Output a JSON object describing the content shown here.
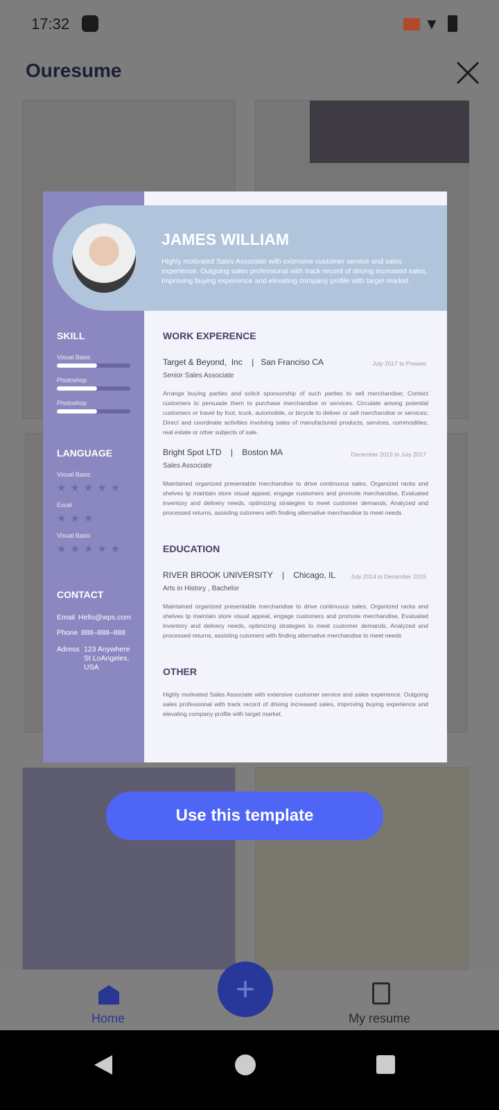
{
  "status": {
    "time": "17:32"
  },
  "app": {
    "title": "Ouresume"
  },
  "preview": {
    "name": "JAMES WILLIAM",
    "summary": "Highly motivated Sales Associate with extensive customer service and sales experience. Outgoing sales professional with track record of driving increased sales,  Improving buying experience and elevating company profile with target market.",
    "skill_title": "SKILL",
    "skills": [
      {
        "label": "Visual Basic",
        "level": 0.55
      },
      {
        "label": "Photoshop",
        "level": 0.55
      },
      {
        "label": "Photoshop",
        "level": 0.55
      }
    ],
    "language_title": "LANGUAGE",
    "languages": [
      {
        "label": "Visual Basic",
        "stars": "★★★★★",
        "rating": 5
      },
      {
        "label": "Excel",
        "stars": "★★★",
        "rating": 3
      },
      {
        "label": "Visual Basic",
        "stars": "★★★★★",
        "rating": 5
      }
    ],
    "contact_title": "CONTACT",
    "contact": {
      "email_label": "Email",
      "email": "Hello@wps.com",
      "phone_label": "Phone",
      "phone": "888–888–888",
      "address_label": "Adress",
      "address": "123 Anywhere St LoAngeles, USA"
    },
    "work_title": "WORK EXPERENCE",
    "jobs": [
      {
        "company": "Target & Beyond,  Inc    |   San Franciso CA",
        "role": "Senior Sales Associate",
        "date": "July 2017 to Present",
        "desc": "Arrange buying parties and solicit sponsorship of such parties to sell merchandise; Contact customers to persuade them to purchase merchandise or services. Circulate among potential customers or travel by foot, truck, automobile, or bicycle to deliver or sell merchandise or services; Direct and coordinate activities involving sales of manufactured products, services, commodities, real estate or other subjects of sale."
      },
      {
        "company": "Bright Spot LTD    |    Boston MA",
        "role": "Sales Associate",
        "date": "December 2015 to July 2017",
        "desc": "Maintained organized presentable merchandise to drive continuous sales, Organized racks and shelves tp maintain store visual appeal, engage customers and promote merchandise, Evaluated inventory and delivery needs, optimizing strategies to meet customer demands, Analyzed and processed returns,  assisting cutomers with finding alternative merchandise to meet needs"
      }
    ],
    "education_title": "EDUCATION",
    "education": {
      "school": "RIVER BROOK UNIVERSITY    |    Chicago, IL",
      "degree": "Arts in History , Bachelor",
      "date": "July 2014 to December 2015",
      "desc": "Maintained organized presentable merchandise to drive continuous sales, Organized racks and shelves tp maintain store visual appeal, engage customers and promote merchandise, Evaluated inventory and delivery needs, optimizing strategies to meet customer demands, Analyzed and processed returns,  assisting cutomers with finding alternative merchandise to meet needs"
    },
    "other_title": "OTHER",
    "other": "Highly motivated Sales Associate with extensive customer service and sales experience. Outgoing sales professional with track record of driving increased sales,  improving buying experience and elevating company profile with target market."
  },
  "use_button": "Use this template",
  "nav": {
    "home": "Home",
    "my_resume": "My resume",
    "add": "+"
  },
  "colors": {
    "accent": "#4e65f6",
    "sidebar": "#8b87c1",
    "band": "#b0c4dc"
  }
}
